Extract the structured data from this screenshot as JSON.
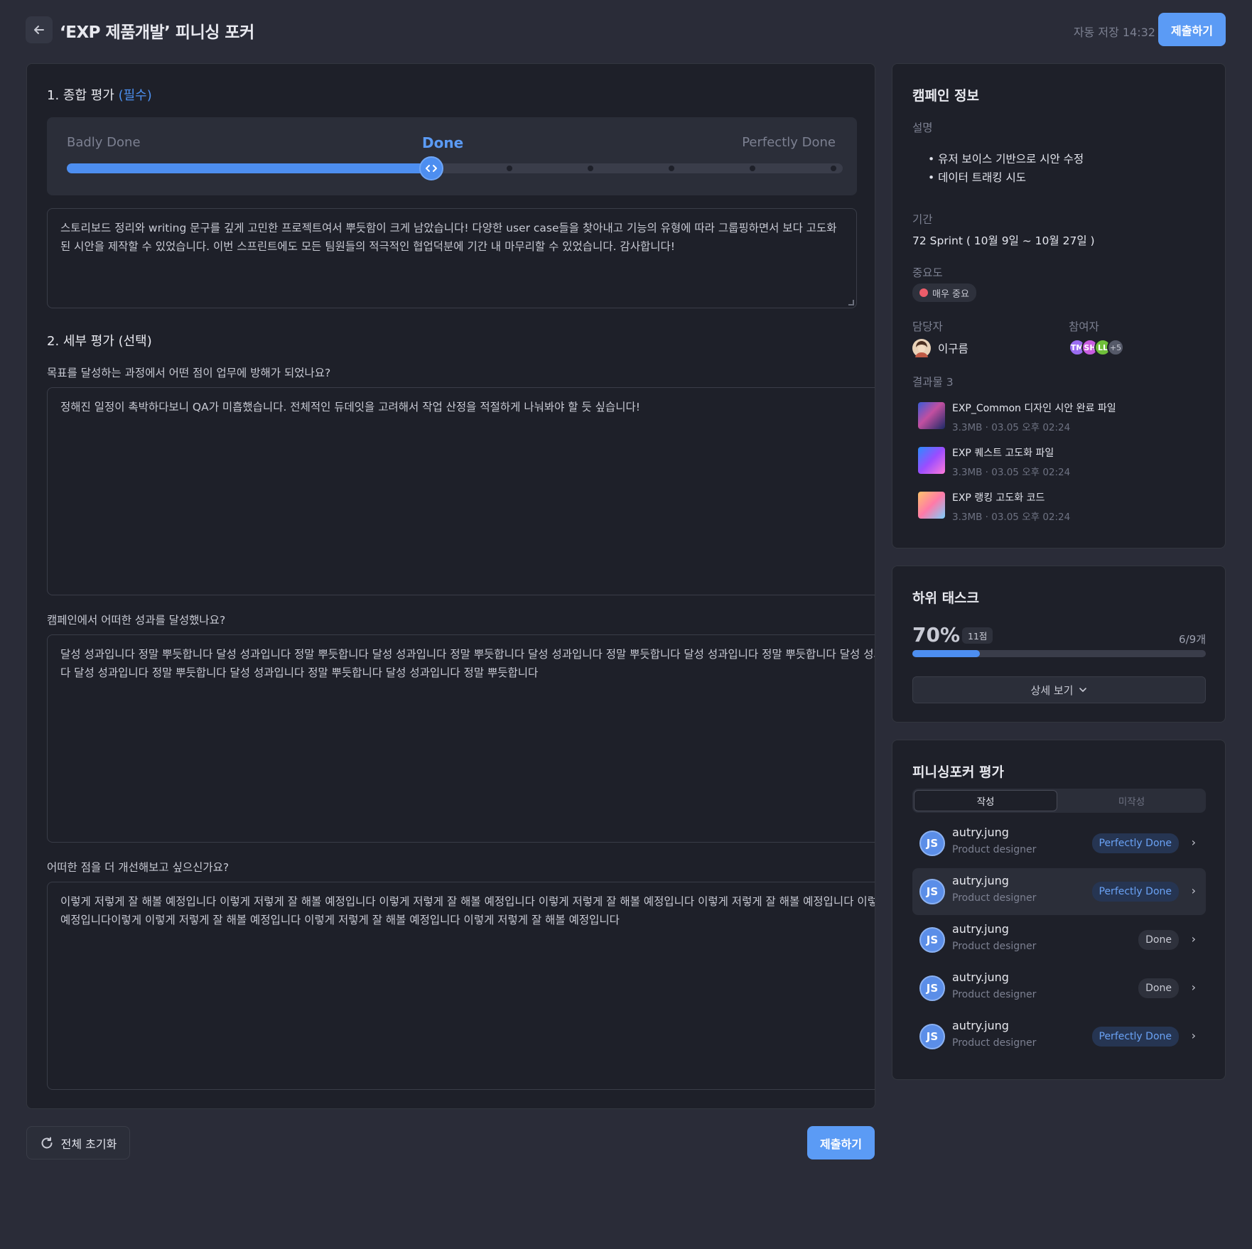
{
  "header": {
    "title": "‘EXP 제품개발’ 피니싱 포커",
    "autosave": "자동 저장 14:32",
    "submit_label": "제출하기"
  },
  "overall": {
    "title": "1. 종합 평가",
    "required": "(필수)",
    "slider": {
      "left_label": "Badly Done",
      "center_label": "Done",
      "right_label": "Perfectly Done",
      "value_fraction": 0.47
    },
    "comment": "스토리보드 정리와 writing 문구를 깊게 고민한 프로젝트여서 뿌듯함이 크게 남았습니다! 다양한 user case들을 찾아내고 기능의 유형에 따라 그룹핑하면서 보다 고도화된 시안을 제작할 수 있었습니다. 이번 스프린트에도 모든 팀원들의 적극적인 협업덕분에 기간 내 마무리할 수 있었습니다. 감사합니다!"
  },
  "detail": {
    "title": "2. 세부 평가 (선택)",
    "questions": [
      {
        "label": "목표를 달성하는 과정에서 어떤 점이 업무에 방해가 되었나요?",
        "answer": "정해진 일정이 촉박하다보니 QA가 미흡했습니다. 전체적인 듀데잇을 고려해서 작업 산정을 적절하게 나눠봐야 할 듯 싶습니다!"
      },
      {
        "label": "캠페인에서 어떠한 성과를 달성했나요?",
        "answer": "달성 성과입니다 정말 뿌듯합니다 달성 성과입니다 정말 뿌듯합니다 달성 성과입니다 정말 뿌듯합니다 달성 성과입니다 정말 뿌듯합니다 달성 성과입니다 정말 뿌듯합니다 달성 성과입니다 정말 뿌듯합니다 달성 성과입니다 정말 뿌듯합니다 달성 성과입니다 정말 뿌듯합니다 달성 성과입니다 정말 뿌듯합니다"
      },
      {
        "label": "어떠한 점을 더 개선해보고 싶으신가요?",
        "answer": "이렇게 저렇게 잘 해볼 예정입니다 이렇게 저렇게 잘 해볼 예정입니다 이렇게 저렇게 잘 해볼 예정입니다 이렇게 저렇게 잘 해볼 예정입니다 이렇게 저렇게 잘 해볼 예정입니다 이렇게 저렇게 잘 해볼 예정입니다이렇게 이렇게 저렇게 잘 해볼 예정입니다 이렇게 저렇게 잘 해볼 예정입니다 이렇게 저렇게 잘 해볼 예정입니다"
      }
    ]
  },
  "footer": {
    "reset_label": "전체 초기화",
    "submit_label": "제출하기"
  },
  "campaign": {
    "title": "캠페인 정보",
    "desc_label": "설명",
    "desc_items": [
      "유저 보이스 기반으로 시안 수정",
      "데이터 트래킹 시도"
    ],
    "period_label": "기간",
    "period": "72 Sprint ( 10월 9일 ~ 10월 27일 )",
    "importance_label": "중요도",
    "importance": "매우 중요",
    "owner_label": "담당자",
    "owner": "이구름",
    "participants_label": "참여자",
    "participants": [
      "TM",
      "SH",
      "LL"
    ],
    "participants_more": "+5",
    "outputs_label": "결과물 3",
    "files": [
      {
        "name": "EXP_Common 디자인 시안 완료 파일",
        "meta": "3.3MB · 03.05 오후 02:24"
      },
      {
        "name": "EXP 퀘스트 고도화 파일",
        "meta": "3.3MB · 03.05 오후 02:24"
      },
      {
        "name": "EXP 랭킹 고도화 코드",
        "meta": "3.3MB · 03.05 오후 02:24"
      }
    ]
  },
  "subtasks": {
    "title": "하위 태스크",
    "percent": "70%",
    "points": "11점",
    "count": "6/9개",
    "progress_fraction": 0.23,
    "detail_label": "상세 보기"
  },
  "evaluations": {
    "title": "피니싱포커 평가",
    "tabs": [
      "작성",
      "미작성"
    ],
    "rows": [
      {
        "initials": "JS",
        "name": "autry.jung",
        "role": "Product designer",
        "tag": "Perfectly Done"
      },
      {
        "initials": "JS",
        "name": "autry.jung",
        "role": "Product designer",
        "tag": "Perfectly Done"
      },
      {
        "initials": "JS",
        "name": "autry.jung",
        "role": "Product designer",
        "tag": "Done"
      },
      {
        "initials": "JS",
        "name": "autry.jung",
        "role": "Product designer",
        "tag": "Done"
      },
      {
        "initials": "JS",
        "name": "autry.jung",
        "role": "Product designer",
        "tag": "Perfectly Done"
      }
    ]
  },
  "colors": {
    "accent": "#5b9bf5",
    "background": "#2a2c38",
    "panel": "#1e2029",
    "important": "#ec5d6a"
  }
}
